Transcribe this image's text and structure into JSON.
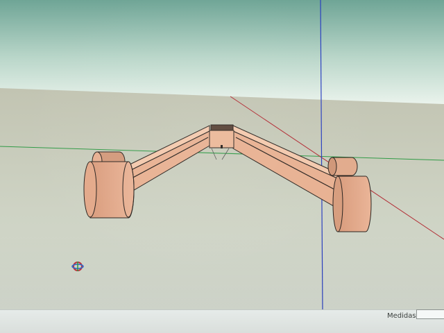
{
  "statusbar": {
    "measurements_label": "Medidas",
    "measurements_value": ""
  },
  "colors": {
    "sky_top": "#7fb3a6",
    "sky_bottom": "#e2efe6",
    "ground": "#ccd1c0",
    "wood_face": "#e9b697",
    "wood_top": "#f3c9ad",
    "wood_dark": "#c08567",
    "edge": "#2a2420",
    "axis_red": "#b22a33",
    "axis_green": "#2f9a45",
    "axis_blue": "#2a3fbf"
  },
  "icons": {
    "orbit_cursor": "orbit-icon"
  }
}
